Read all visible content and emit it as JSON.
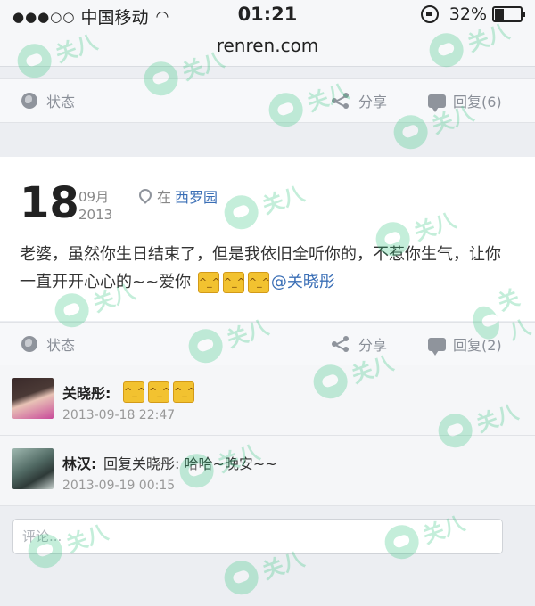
{
  "status_bar": {
    "signal_dots": "●●●○○",
    "carrier": "中国移动",
    "wifi_icon": "wifi-icon",
    "time": "01:21",
    "battery": "32%",
    "battery_level": 0.32
  },
  "browser": {
    "url": "renren.com"
  },
  "top_actions": {
    "status": "状态",
    "share": "分享",
    "reply": "回复(6)"
  },
  "post": {
    "day": "18",
    "month": "09月",
    "year": "2013",
    "location_prefix": "在",
    "location": "西罗园",
    "text": "老婆，虽然你生日结束了，但是我依旧全听你的，不惹你生气，让你一直开开心心的~~爱你",
    "emoji": "emoji-face-icon",
    "mention": "@关晓彤",
    "actions": {
      "status": "状态",
      "share": "分享",
      "reply": "回复(2)"
    }
  },
  "comments": [
    {
      "name": "关晓彤:",
      "text": "",
      "time": "2013-09-18 22:47"
    },
    {
      "name": "林汉:",
      "text": "回复关晓彤: 哈哈~晚安~~",
      "time": "2013-09-19 00:15"
    }
  ],
  "comment_input": {
    "placeholder": "评论..."
  },
  "watermark": {
    "text": "关八",
    "color": "#2fc47c"
  }
}
